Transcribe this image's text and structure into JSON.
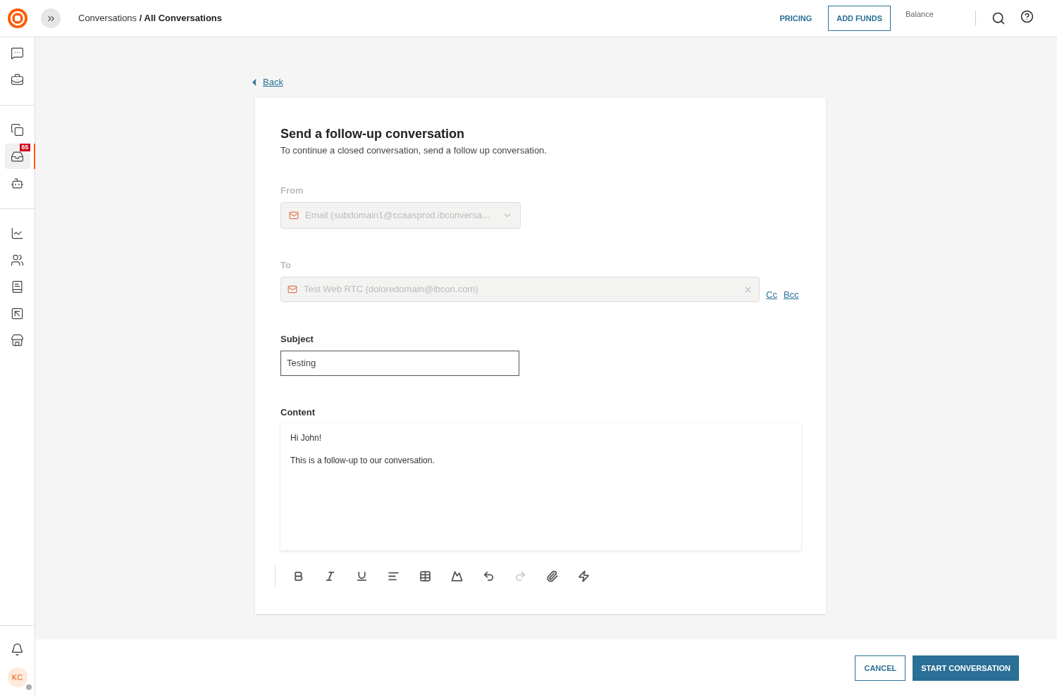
{
  "header": {
    "breadcrumb": {
      "parent": "Conversations",
      "separator": "/",
      "current": "All Conversations"
    },
    "pricing": "PRICING",
    "add_funds": "ADD FUNDS",
    "balance_label": "Balance"
  },
  "sidebar": {
    "groups": [
      [
        {
          "kind": "chat",
          "selected": false
        },
        {
          "kind": "code",
          "selected": false
        }
      ],
      [
        {
          "kind": "copy",
          "selected": false
        },
        {
          "kind": "inbox",
          "selected": true,
          "badge": "65"
        },
        {
          "kind": "bot",
          "selected": false
        }
      ],
      [
        {
          "kind": "chart",
          "selected": false
        },
        {
          "kind": "users",
          "selected": false
        },
        {
          "kind": "book",
          "selected": false
        },
        {
          "kind": "cursor",
          "selected": false
        },
        {
          "kind": "store",
          "selected": false
        }
      ]
    ],
    "avatar": "KC"
  },
  "back": "Back",
  "form": {
    "title": "Send a follow-up conversation",
    "subtitle": "To continue a closed conversation, send a follow up conversation.",
    "from": {
      "label": "From",
      "value": "Email (subdomain1@ccaasprod.ibconversa...",
      "disabled": true
    },
    "to": {
      "label": "To",
      "value": "Test Web RTC (doloredomain@ibcon.com)",
      "disabled": true,
      "cc": "Cc",
      "bcc": "Bcc"
    },
    "subject": {
      "label": "Subject",
      "value": "Testing"
    },
    "content": {
      "label": "Content",
      "paragraphs": [
        "Hi John!",
        "This is a follow-up to our conversation."
      ]
    },
    "toolbar": [
      {
        "kind": "bold",
        "disabled": false
      },
      {
        "kind": "italic",
        "disabled": false
      },
      {
        "kind": "underline",
        "disabled": false
      },
      {
        "kind": "align",
        "disabled": false
      },
      {
        "kind": "table",
        "disabled": false
      },
      {
        "kind": "image",
        "disabled": false
      },
      {
        "kind": "undo",
        "disabled": false
      },
      {
        "kind": "redo",
        "disabled": true
      },
      {
        "kind": "attach",
        "disabled": false
      },
      {
        "kind": "bolt",
        "disabled": false
      }
    ]
  },
  "footer": {
    "cancel": "CANCEL",
    "start": "START CONVERSATION"
  }
}
